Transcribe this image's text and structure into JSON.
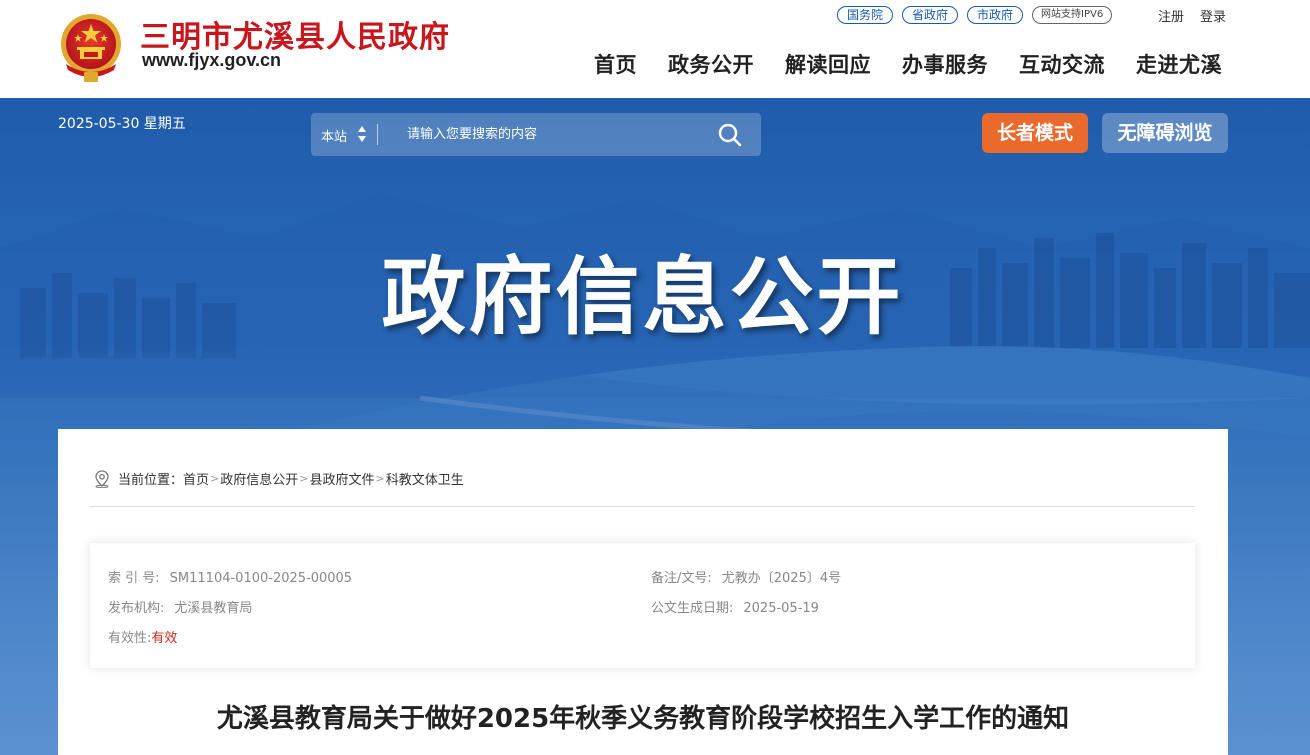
{
  "header": {
    "site_title": "三明市尤溪县人民政府",
    "site_url": "www.fjyx.gov.cn",
    "emblem_icon": "national-emblem-icon",
    "top_links": [
      "国务院",
      "省政府",
      "市政府"
    ],
    "ipv6_badge": "网站支持IPV6",
    "register": "注册",
    "login": "登录",
    "nav": [
      "首页",
      "政务公开",
      "解读回应",
      "办事服务",
      "互动交流",
      "走进尤溪"
    ]
  },
  "banner": {
    "date": "2025-05-30 星期五",
    "search": {
      "scope": "本站",
      "placeholder": "请输入您要搜索的内容",
      "icon": "search-icon"
    },
    "elder_mode": "长者模式",
    "accessibility": "无障碍浏览",
    "title": "政府信息公开"
  },
  "content": {
    "breadcrumb_label": "当前位置：",
    "breadcrumb": [
      "首页",
      "政府信息公开",
      "县政府文件",
      "科教文体卫生"
    ],
    "meta": {
      "index_label": "索 引 号:",
      "index_value": "SM11104-0100-2025-00005",
      "doc_no_label": "备注/文号:",
      "doc_no_value": "尤教办〔2025〕4号",
      "publisher_label": "发布机构:",
      "publisher_value": "尤溪县教育局",
      "date_label": "公文生成日期:",
      "date_value": "2025-05-19",
      "validity_label": "有效性:",
      "validity_value": "有效"
    },
    "article_title": "尤溪县教育局关于做好2025年秋季义务教育阶段学校招生入学工作的通知"
  },
  "colors": {
    "brand_red": "#c8161d",
    "link_blue": "#1a5bb0",
    "banner_blue": "#2a6ab8",
    "elder_orange": "#ea6a2d",
    "valid_red": "#d3281c"
  }
}
